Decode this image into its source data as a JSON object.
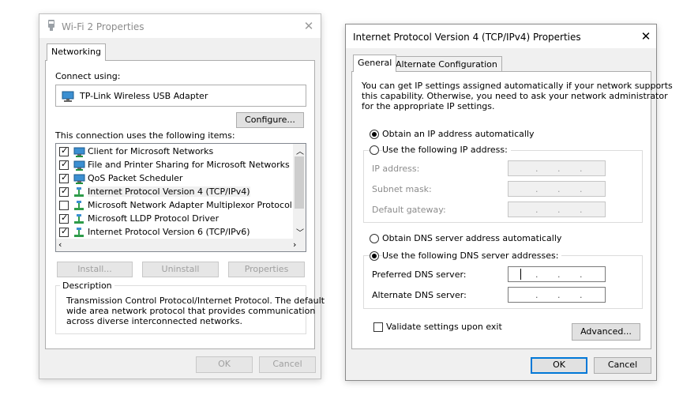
{
  "left": {
    "title": "Wi-Fi 2 Properties",
    "tab": "Networking",
    "connect_using": "Connect using:",
    "adapter": "TP-Link Wireless USB Adapter",
    "configure": "Configure...",
    "items_label": "This connection uses the following items:",
    "items": [
      {
        "label": "Client for Microsoft Networks",
        "checked": true
      },
      {
        "label": "File and Printer Sharing for Microsoft Networks",
        "checked": true
      },
      {
        "label": "QoS Packet Scheduler",
        "checked": true
      },
      {
        "label": "Internet Protocol Version 4 (TCP/IPv4)",
        "checked": true,
        "selected": true
      },
      {
        "label": "Microsoft Network Adapter Multiplexor Protocol",
        "checked": false
      },
      {
        "label": "Microsoft LLDP Protocol Driver",
        "checked": true
      },
      {
        "label": "Internet Protocol Version 6 (TCP/IPv6)",
        "checked": true
      }
    ],
    "install": "Install...",
    "uninstall": "Uninstall",
    "properties": "Properties",
    "description_label": "Description",
    "description_lines": [
      "Transmission Control Protocol/Internet Protocol. The default",
      "wide area network protocol that provides communication",
      "across diverse interconnected networks."
    ],
    "ok": "OK",
    "cancel": "Cancel"
  },
  "right": {
    "title": "Internet Protocol Version 4 (TCP/IPv4) Properties",
    "tab_general": "General",
    "tab_alternate": "Alternate Configuration",
    "info_lines": [
      "You can get IP settings assigned automatically if your network supports",
      "this capability. Otherwise, you need to ask your network administrator",
      "for the appropriate IP settings."
    ],
    "radio_obtain_ip": "Obtain an IP address automatically",
    "radio_use_ip": "Use the following IP address:",
    "ip_address": "IP address:",
    "subnet_mask": "Subnet mask:",
    "default_gateway": "Default gateway:",
    "radio_obtain_dns": "Obtain DNS server address automatically",
    "radio_use_dns": "Use the following DNS server addresses:",
    "preferred_dns": "Preferred DNS server:",
    "alternate_dns": "Alternate DNS server:",
    "validate": "Validate settings upon exit",
    "advanced": "Advanced...",
    "ok": "OK",
    "cancel": "Cancel"
  }
}
